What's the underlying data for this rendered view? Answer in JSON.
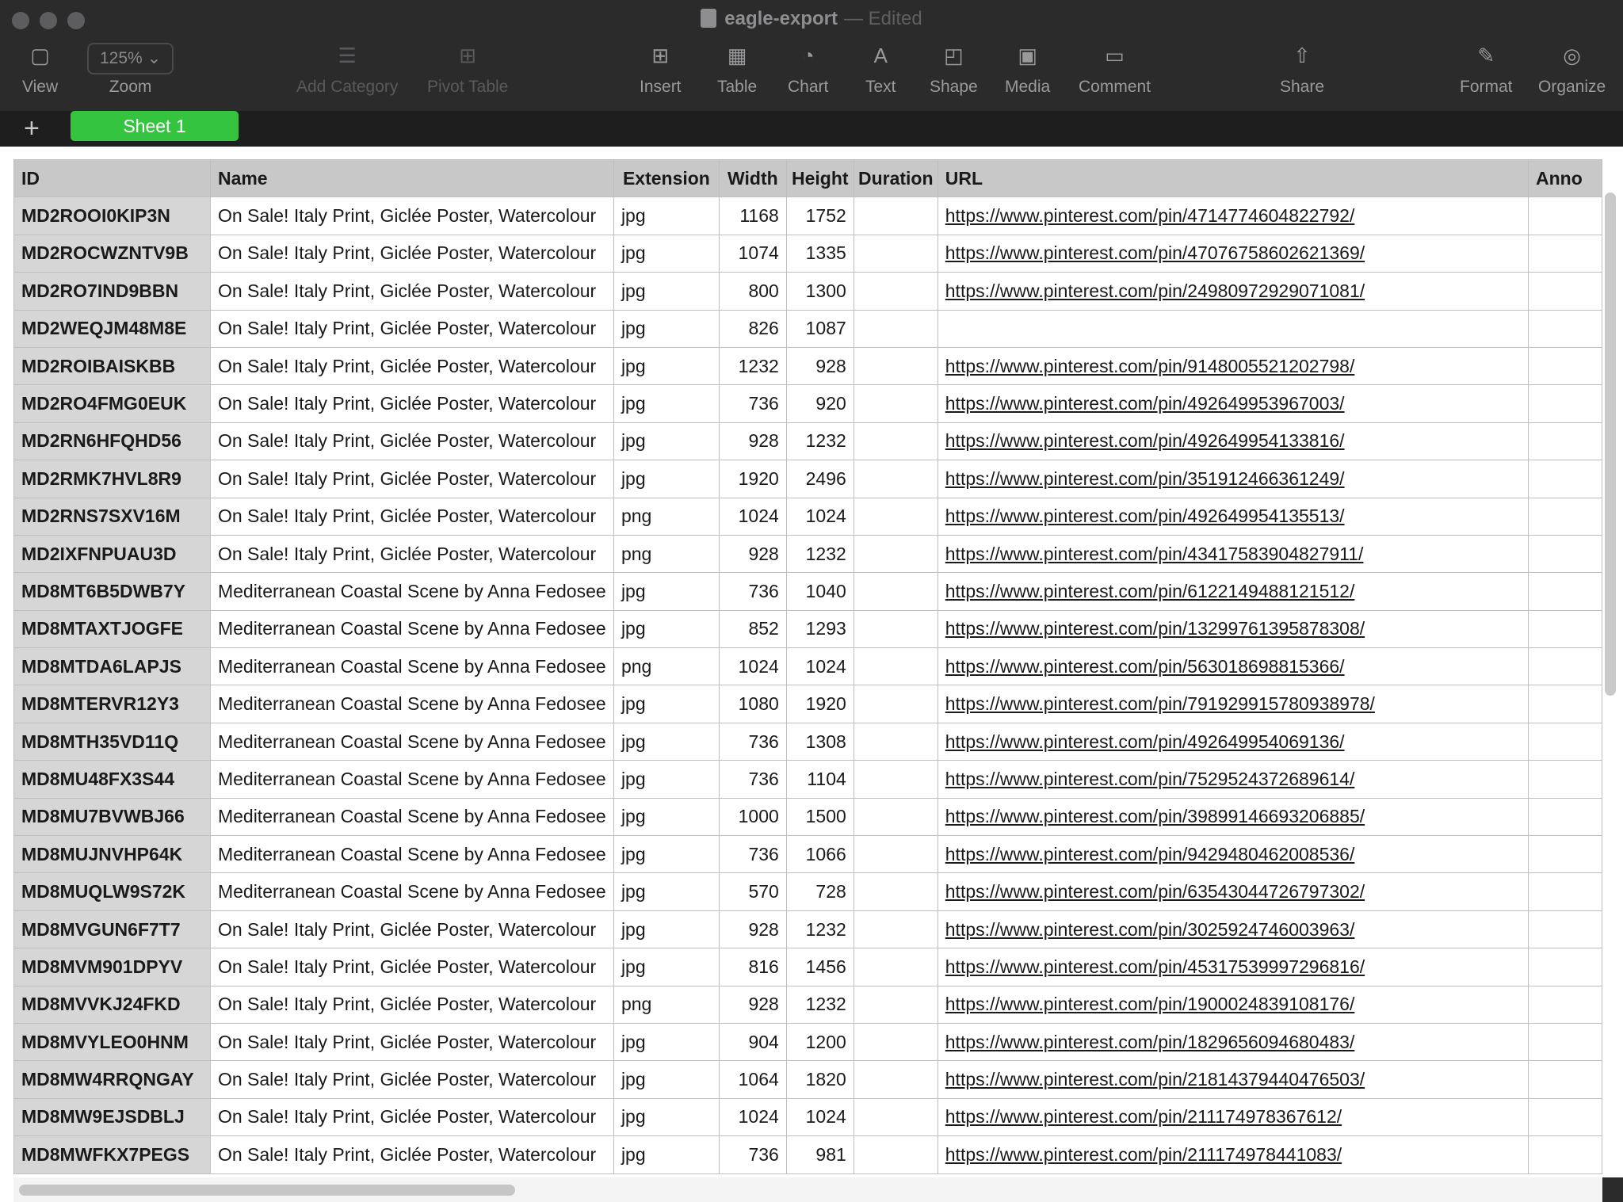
{
  "window": {
    "title": "eagle-export",
    "status": "— Edited"
  },
  "toolbar": {
    "view": "View",
    "zoom_value": "125%",
    "zoom": "Zoom",
    "add_category": "Add Category",
    "pivot_table": "Pivot Table",
    "insert": "Insert",
    "table": "Table",
    "chart": "Chart",
    "text": "Text",
    "shape": "Shape",
    "media": "Media",
    "comment": "Comment",
    "share": "Share",
    "format": "Format",
    "organize": "Organize"
  },
  "sheets": {
    "add": "+",
    "active": "Sheet 1"
  },
  "table": {
    "headers": [
      "ID",
      "Name",
      "Extension",
      "Width",
      "Height",
      "Duration",
      "URL",
      "Anno"
    ],
    "rows": [
      [
        "MD2ROOI0KIP3N",
        "On Sale! Italy Print, Giclée Poster, Watercolour",
        "jpg",
        "1168",
        "1752",
        "",
        "https://www.pinterest.com/pin/47147746048227​92/"
      ],
      [
        "MD2ROCWZNTV9B",
        "On Sale! Italy Print, Giclée Poster, Watercolour",
        "jpg",
        "1074",
        "1335",
        "",
        "https://www.pinterest.com/pin/470767586026213​69/"
      ],
      [
        "MD2RO7IND9BBN",
        "On Sale! Italy Print, Giclée Poster, Watercolour",
        "jpg",
        "800",
        "1300",
        "",
        "https://www.pinterest.com/pin/249809729290710​81/"
      ],
      [
        "MD2WEQJM48M8E",
        "On Sale! Italy Print, Giclée Poster, Watercolour",
        "jpg",
        "826",
        "1087",
        "",
        ""
      ],
      [
        "MD2ROIBAISKBB",
        "On Sale! Italy Print, Giclée Poster, Watercolour",
        "jpg",
        "1232",
        "928",
        "",
        "https://www.pinterest.com/pin/9148005521202798/"
      ],
      [
        "MD2RO4FMG0EUK",
        "On Sale! Italy Print, Giclée Poster, Watercolour",
        "jpg",
        "736",
        "920",
        "",
        "https://www.pinterest.com/pin/492649953967003/"
      ],
      [
        "MD2RN6HFQHD56",
        "On Sale! Italy Print, Giclée Poster, Watercolour",
        "jpg",
        "928",
        "1232",
        "",
        "https://www.pinterest.com/pin/492649954133816/"
      ],
      [
        "MD2RMK7HVL8R9",
        "On Sale! Italy Print, Giclée Poster, Watercolour",
        "jpg",
        "1920",
        "2496",
        "",
        "https://www.pinterest.com/pin/351912466361249/"
      ],
      [
        "MD2RNS7SXV16M",
        "On Sale! Italy Print, Giclée Poster, Watercolour",
        "png",
        "1024",
        "1024",
        "",
        "https://www.pinterest.com/pin/492649954135513/"
      ],
      [
        "MD2IXFNPUAU3D",
        "On Sale! Italy Print, Giclée Poster, Watercolour",
        "png",
        "928",
        "1232",
        "",
        "https://www.pinterest.com/pin/43417583904827911/"
      ],
      [
        "MD8MT6B5DWB7Y",
        "Mediterranean Coastal Scene by Anna Fedosee",
        "jpg",
        "736",
        "1040",
        "",
        "https://www.pinterest.com/pin/6122149488121512/"
      ],
      [
        "MD8MTAXTJOGFE",
        "Mediterranean Coastal Scene by Anna Fedosee",
        "jpg",
        "852",
        "1293",
        "",
        "https://www.pinterest.com/pin/13299761395878308/"
      ],
      [
        "MD8MTDA6LAPJS",
        "Mediterranean Coastal Scene by Anna Fedosee",
        "png",
        "1024",
        "1024",
        "",
        "https://www.pinterest.com/pin/563018698815366/"
      ],
      [
        "MD8MTERVR12Y3",
        "Mediterranean Coastal Scene by Anna Fedosee",
        "jpg",
        "1080",
        "1920",
        "",
        "https://www.pinterest.com/pin/791929915780938978/"
      ],
      [
        "MD8MTH35VD11Q",
        "Mediterranean Coastal Scene by Anna Fedosee",
        "jpg",
        "736",
        "1308",
        "",
        "https://www.pinterest.com/pin/492649954069136/"
      ],
      [
        "MD8MU48FX3S44",
        "Mediterranean Coastal Scene by Anna Fedosee",
        "jpg",
        "736",
        "1104",
        "",
        "https://www.pinterest.com/pin/7529524372689614/"
      ],
      [
        "MD8MU7BVWBJ66",
        "Mediterranean Coastal Scene by Anna Fedosee",
        "jpg",
        "1000",
        "1500",
        "",
        "https://www.pinterest.com/pin/39899146693206885/"
      ],
      [
        "MD8MUJNVHP64K",
        "Mediterranean Coastal Scene by Anna Fedosee",
        "jpg",
        "736",
        "1066",
        "",
        "https://www.pinterest.com/pin/9429480462008536/"
      ],
      [
        "MD8MUQLW9S72K",
        "Mediterranean Coastal Scene by Anna Fedosee",
        "jpg",
        "570",
        "728",
        "",
        "https://www.pinterest.com/pin/63543044726797302/"
      ],
      [
        "MD8MVGUN6F7T7",
        "On Sale! Italy Print, Giclée Poster, Watercolour",
        "jpg",
        "928",
        "1232",
        "",
        "https://www.pinterest.com/pin/3025924746003963/"
      ],
      [
        "MD8MVM901DPYV",
        "On Sale! Italy Print, Giclée Poster, Watercolour",
        "jpg",
        "816",
        "1456",
        "",
        "https://www.pinterest.com/pin/45317539997296816/"
      ],
      [
        "MD8MVVKJ24FKD",
        "On Sale! Italy Print, Giclée Poster, Watercolour",
        "png",
        "928",
        "1232",
        "",
        "https://www.pinterest.com/pin/1900024839108176/"
      ],
      [
        "MD8MVYLEO0HNM",
        "On Sale! Italy Print, Giclée Poster, Watercolour",
        "jpg",
        "904",
        "1200",
        "",
        "https://www.pinterest.com/pin/1829656094680483/"
      ],
      [
        "MD8MW4RRQNGAY",
        "On Sale! Italy Print, Giclée Poster, Watercolour",
        "jpg",
        "1064",
        "1820",
        "",
        "https://www.pinterest.com/pin/21814379440476503/"
      ],
      [
        "MD8MW9EJSDBLJ",
        "On Sale! Italy Print, Giclée Poster, Watercolour",
        "jpg",
        "1024",
        "1024",
        "",
        "https://www.pinterest.com/pin/211174978367612/"
      ],
      [
        "MD8MWFKX7PEGS",
        "On Sale! Italy Print, Giclée Poster, Watercolour",
        "jpg",
        "736",
        "981",
        "",
        "https://www.pinterest.com/pin/211174978441083/"
      ]
    ]
  }
}
